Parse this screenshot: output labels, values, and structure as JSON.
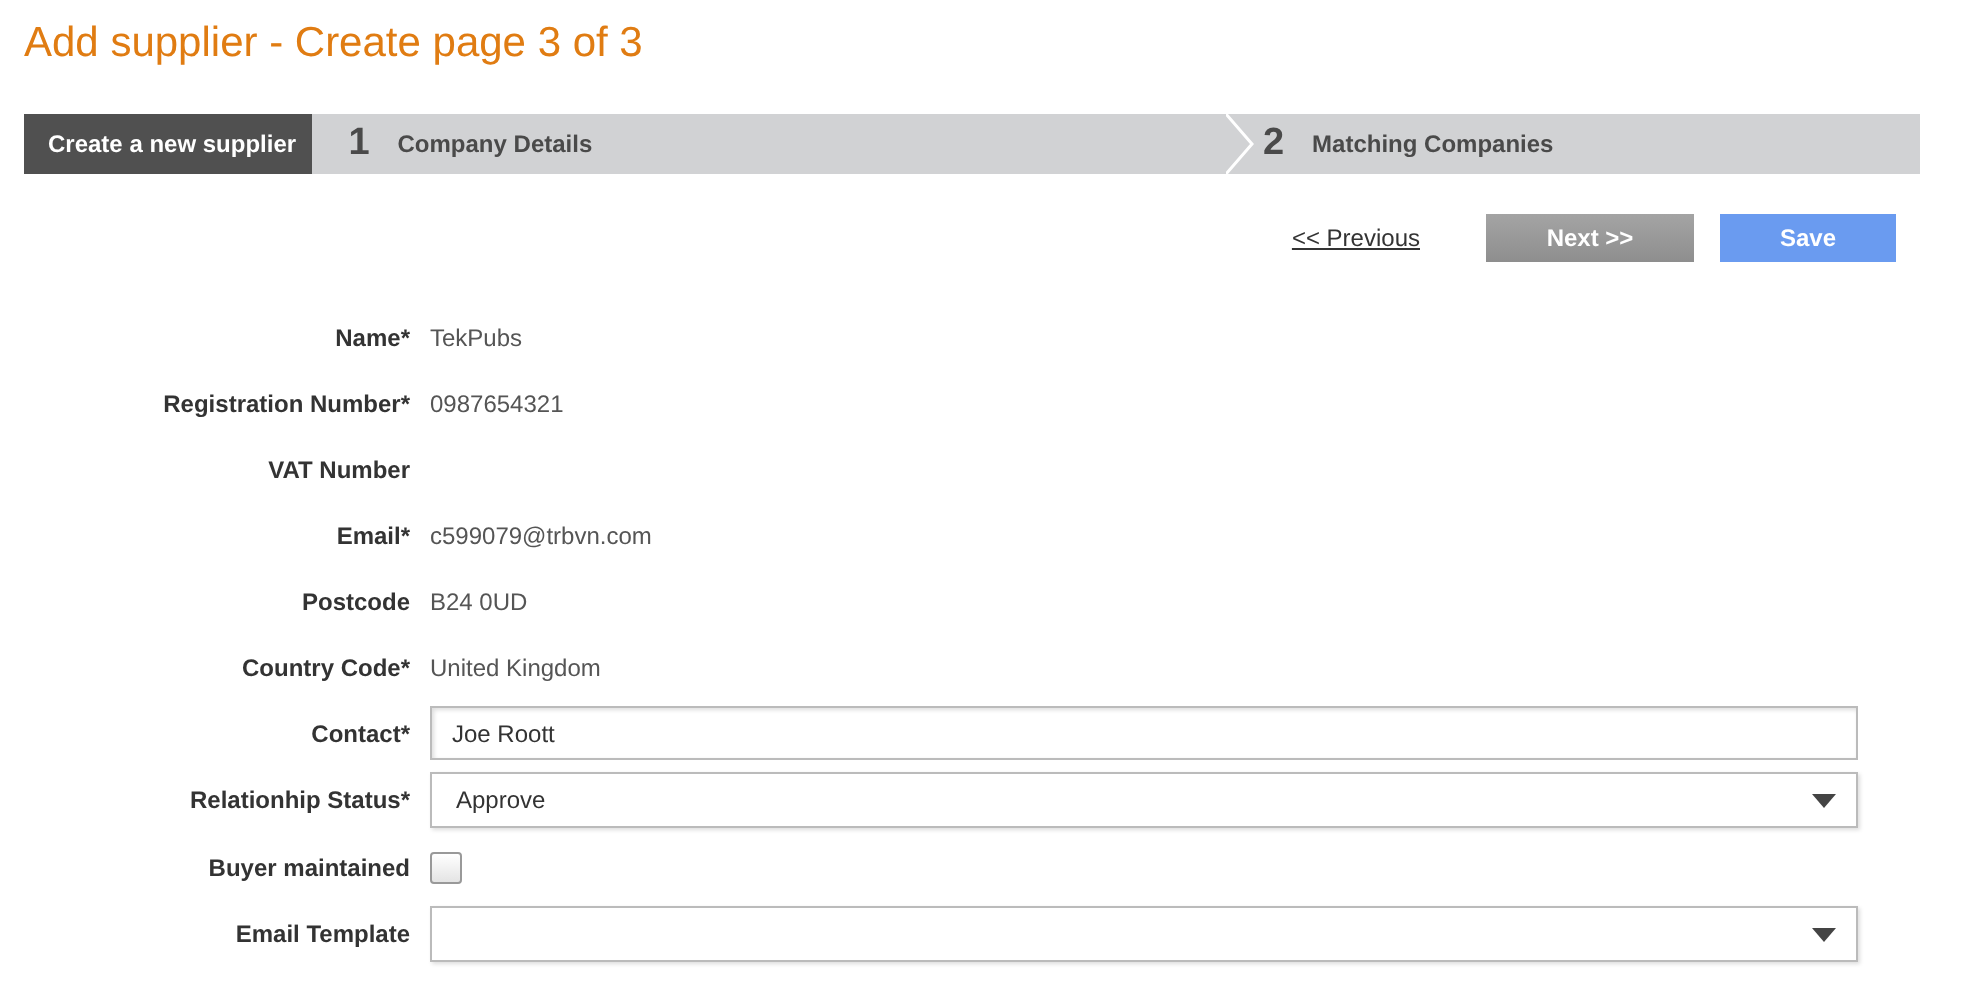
{
  "title": "Add supplier - Create page 3 of 3",
  "steps": [
    {
      "label": "Create a new supplier",
      "selected": true
    },
    {
      "number": "1",
      "label": "Company Details",
      "selected": false
    },
    {
      "number": "2",
      "label": "Matching Companies",
      "selected": false
    }
  ],
  "actions": {
    "previous": "<< Previous",
    "next": {
      "label": "Next >>",
      "disabled": true
    },
    "save": "Save"
  },
  "fields": [
    {
      "kind": "text",
      "label": "Name*",
      "value": "TekPubs"
    },
    {
      "kind": "text",
      "label": "Registration Number*",
      "value": "0987654321"
    },
    {
      "kind": "text",
      "label": "VAT Number"
    },
    {
      "kind": "text",
      "label": "Email*",
      "value": "c599079@trbvn.com"
    },
    {
      "kind": "text",
      "label": "Postcode",
      "value": "B24 0UD"
    },
    {
      "kind": "text",
      "label": "Country Code*",
      "value": "United Kingdom"
    },
    {
      "kind": "input",
      "label": "Contact*",
      "value": "Joe Roott"
    },
    {
      "kind": "select",
      "label": "Relationhip Status*",
      "value": "Approve"
    },
    {
      "kind": "checkbox",
      "label": "Buyer maintained",
      "checked": false
    },
    {
      "kind": "select",
      "label": "Email Template"
    }
  ]
}
